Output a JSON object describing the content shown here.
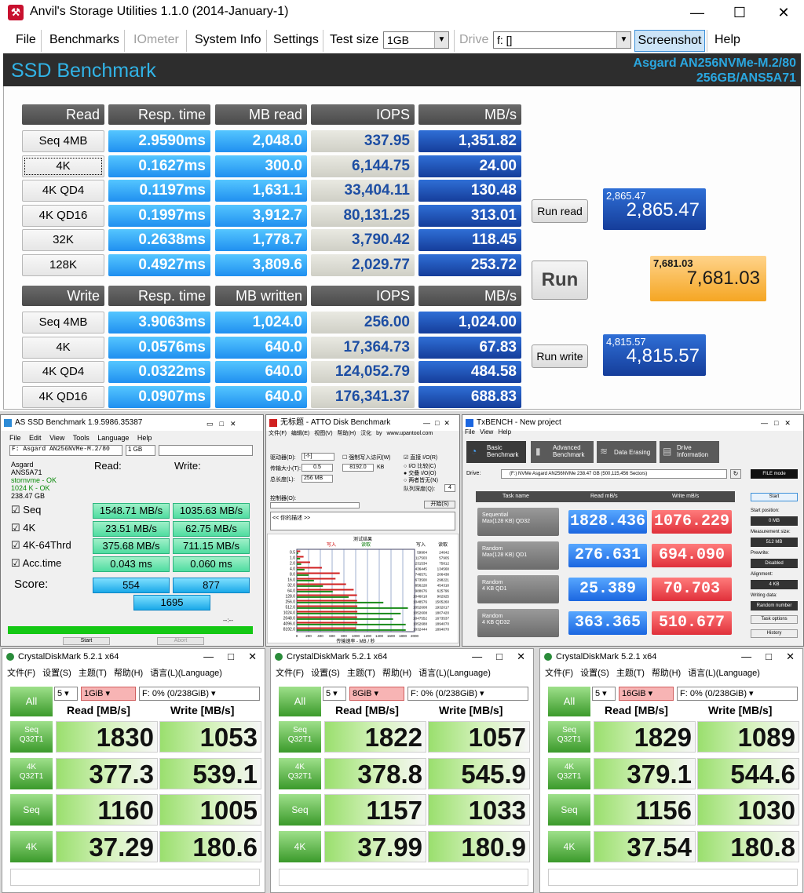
{
  "anvil": {
    "window_title": "Anvil's Storage Utilities 1.1.0 (2014-January-1)",
    "app_icon": "anvil-app-icon",
    "controls": {
      "minimize": "—",
      "maximize": "☐",
      "close": "✕"
    },
    "menu": {
      "file": "File",
      "benchmarks": "Benchmarks",
      "iometer": "IOmeter",
      "system_info": "System Info",
      "settings": "Settings",
      "test_size_label": "Test size",
      "test_size_value": "1GB",
      "drive_label": "Drive",
      "drive_value": "f: []",
      "screenshot": "Screenshot",
      "help": "Help"
    },
    "header": {
      "title": "SSD Benchmark",
      "model_line1": "Asgard AN256NVMe-M.2/80",
      "model_line2": "256GB/ANS5A71"
    },
    "read_headers": [
      "Read",
      "Resp. time",
      "MB read",
      "IOPS",
      "MB/s"
    ],
    "read_rows": [
      {
        "label": "Seq 4MB",
        "resp": "2.9590ms",
        "mb": "2,048.0",
        "iops": "337.95",
        "mbs": "1,351.82"
      },
      {
        "label": "4K",
        "resp": "0.1627ms",
        "mb": "300.0",
        "iops": "6,144.75",
        "mbs": "24.00"
      },
      {
        "label": "4K QD4",
        "resp": "0.1197ms",
        "mb": "1,631.1",
        "iops": "33,404.11",
        "mbs": "130.48"
      },
      {
        "label": "4K QD16",
        "resp": "0.1997ms",
        "mb": "3,912.7",
        "iops": "80,131.25",
        "mbs": "313.01"
      },
      {
        "label": "32K",
        "resp": "0.2638ms",
        "mb": "1,778.7",
        "iops": "3,790.42",
        "mbs": "118.45"
      },
      {
        "label": "128K",
        "resp": "0.4927ms",
        "mb": "3,809.6",
        "iops": "2,029.77",
        "mbs": "253.72"
      }
    ],
    "write_headers": [
      "Write",
      "Resp. time",
      "MB written",
      "IOPS",
      "MB/s"
    ],
    "write_rows": [
      {
        "label": "Seq 4MB",
        "resp": "3.9063ms",
        "mb": "1,024.0",
        "iops": "256.00",
        "mbs": "1,024.00"
      },
      {
        "label": "4K",
        "resp": "0.0576ms",
        "mb": "640.0",
        "iops": "17,364.73",
        "mbs": "67.83"
      },
      {
        "label": "4K QD4",
        "resp": "0.0322ms",
        "mb": "640.0",
        "iops": "124,052.79",
        "mbs": "484.58"
      },
      {
        "label": "4K QD16",
        "resp": "0.0907ms",
        "mb": "640.0",
        "iops": "176,341.37",
        "mbs": "688.83"
      }
    ],
    "run_read": "Run read",
    "run": "Run",
    "run_write": "Run write",
    "score_read": {
      "small": "2,865.47",
      "big": "2,865.47"
    },
    "score_total": {
      "small": "7,681.03",
      "big": "7,681.03"
    },
    "score_write": {
      "small": "4,815.57",
      "big": "4,815.57"
    },
    "colors": {
      "header_bg": "#2d2d2d",
      "title": "#31b3e6",
      "light_blue": "#1f8ff0",
      "dark_blue": "#153d9a",
      "orange": "#f5a623"
    }
  },
  "asssd": {
    "title": "AS SSD Benchmark 1.9.5986.35387",
    "menu": [
      "File",
      "Edit",
      "View",
      "Tools",
      "Language",
      "Help"
    ],
    "drive_select": "F: Asgard AN256NVMe-M.2/80",
    "size_select": "1 GB",
    "info": [
      "Asgard",
      "ANS5A71",
      "stornvme - OK",
      "1024 K - OK",
      "238.47 GB"
    ],
    "read_hdr": "Read:",
    "write_hdr": "Write:",
    "rows": [
      {
        "label": "Seq",
        "read": "1548.71 MB/s",
        "write": "1035.63 MB/s"
      },
      {
        "label": "4K",
        "read": "23.51 MB/s",
        "write": "62.75 MB/s"
      },
      {
        "label": "4K-64Thrd",
        "read": "375.68 MB/s",
        "write": "711.15 MB/s"
      },
      {
        "label": "Acc.time",
        "read": "0.043 ms",
        "write": "0.060 ms"
      }
    ],
    "score_label": "Score:",
    "score_read": "554",
    "score_write": "877",
    "score_total": "1695",
    "time": "--:--",
    "start": "Start",
    "abort": "Abort"
  },
  "atto": {
    "title": "无标题 - ATTO Disk Benchmark",
    "menu": [
      "文件(F)",
      "编辑(E)",
      "视图(V)",
      "帮助(H)",
      "汉化 by www.upantool.com"
    ],
    "drive_label": "驱动器(D):",
    "drive_value": "[-f-]",
    "xfer_label": "传输大小(T):",
    "xfer_from": "0.5",
    "xfer_to": "8192.0",
    "xfer_unit": "KB",
    "len_label": "总长度(L):",
    "len_value": "256 MB",
    "force_write": "强制写入访问(W)",
    "direct_io": "直接 I/O(R)",
    "io_compare": "I/O 比较(C)",
    "overlap_io": "交叠 I/O(O)",
    "neither": "两者皆无(N)",
    "queue_label": "队列深度(Q):",
    "queue_value": "4",
    "ctrl_label": "控制器(O):",
    "start": "开始(S)",
    "desc_label": "<< 你的描述 >>",
    "chart_title": "测试结果",
    "legend_write": "写入",
    "legend_read": "读取",
    "xlabel": "传输速率 - MB / 秒",
    "col_write": "写入",
    "col_read": "读取",
    "chart_data": {
      "type": "bar",
      "categories": [
        "0.5",
        "1.0",
        "2.0",
        "4.0",
        "8.0",
        "16.0",
        "32.0",
        "64.0",
        "128.0",
        "256.0",
        "512.0",
        "1024.0",
        "2048.0",
        "4096.0",
        "8192.0"
      ],
      "xlim": [
        0,
        2000
      ],
      "xticks": [
        "0",
        "200",
        "400",
        "600",
        "800",
        "1000",
        "1200",
        "1400",
        "1600",
        "1800",
        "2000"
      ],
      "series": [
        {
          "name": "写入",
          "values": [
            59904,
            117503,
            231534,
            436445,
            746571,
            673500,
            856228,
            988676,
            1046018,
            1048576,
            1052608,
            1052608,
            1047552,
            1052688,
            1032444
          ]
        },
        {
          "name": "读取",
          "values": [
            24642,
            57905,
            75812,
            134568,
            206438,
            298221,
            454318,
            625796,
            902925,
            1505260,
            1932017,
            1807420,
            1673537,
            1894070,
            1894070
          ]
        }
      ]
    }
  },
  "txbench": {
    "title": "TxBENCH - New project",
    "menu": [
      "File",
      "View",
      "Help"
    ],
    "tabs": [
      "Basic Benchmark",
      "Advanced Benchmark",
      "Data Erasing",
      "Drive Information"
    ],
    "drive_label": "Drive:",
    "drive_value": "(F:) NVMe Asgard AN256NVMe  238.47 GB (500,115,456 Sectors)",
    "mode": "FILE mode",
    "cols": [
      "Task name",
      "Read mB/s",
      "Write mB/s"
    ],
    "rows": [
      {
        "name1": "Sequential",
        "name2": "Max(128 KB) QD32",
        "read": "1828.436",
        "write": "1076.229"
      },
      {
        "name1": "Random",
        "name2": "Max(128 KB) QD1",
        "read": "276.631",
        "write": "694.090"
      },
      {
        "name1": "Random",
        "name2": "4 KB QD1",
        "read": "25.389",
        "write": "70.703"
      },
      {
        "name1": "Random",
        "name2": "4 KB QD32",
        "read": "363.365",
        "write": "510.677"
      }
    ],
    "side": {
      "start": "Start",
      "start_pos_label": "Start position:",
      "start_pos": "0 MB",
      "meas_label": "Measurement size:",
      "meas": "512 MB",
      "prewrite_label": "Prewrite:",
      "prewrite": "Disabled",
      "align_label": "Alignment:",
      "align": "4 KB",
      "wdata_label": "Writing data:",
      "wdata": "Random number",
      "task_options": "Task options",
      "history": "History"
    }
  },
  "cdm": [
    {
      "title": "CrystalDiskMark 5.2.1 x64",
      "menu": "文件(F) 设置(S) 主题(T) 帮助(H) 语言(L)(Language)",
      "all": "All",
      "count": "5",
      "size": "1GiB",
      "drive": "F: 0% (0/238GiB)",
      "read_hdr": "Read [MB/s]",
      "write_hdr": "Write [MB/s]",
      "rows": [
        {
          "l1": "Seq",
          "l2": "Q32T1",
          "read": "1830",
          "write": "1053"
        },
        {
          "l1": "4K",
          "l2": "Q32T1",
          "read": "377.3",
          "write": "539.1"
        },
        {
          "l1": "Seq",
          "l2": "",
          "read": "1160",
          "write": "1005"
        },
        {
          "l1": "4K",
          "l2": "",
          "read": "37.29",
          "write": "180.6"
        }
      ]
    },
    {
      "title": "CrystalDiskMark 5.2.1 x64",
      "menu": "文件(F) 设置(S) 主题(T) 帮助(H) 语言(L)(Language)",
      "all": "All",
      "count": "5",
      "size": "8GiB",
      "drive": "F: 0% (0/238GiB)",
      "read_hdr": "Read [MB/s]",
      "write_hdr": "Write [MB/s]",
      "rows": [
        {
          "l1": "Seq",
          "l2": "Q32T1",
          "read": "1822",
          "write": "1057"
        },
        {
          "l1": "4K",
          "l2": "Q32T1",
          "read": "378.8",
          "write": "545.9"
        },
        {
          "l1": "Seq",
          "l2": "",
          "read": "1157",
          "write": "1033"
        },
        {
          "l1": "4K",
          "l2": "",
          "read": "37.99",
          "write": "180.9"
        }
      ]
    },
    {
      "title": "CrystalDiskMark 5.2.1 x64",
      "menu": "文件(F) 设置(S) 主题(T) 帮助(H) 语言(L)(Language)",
      "all": "All",
      "count": "5",
      "size": "16GiB",
      "drive": "F: 0% (0/238GiB)",
      "read_hdr": "Read [MB/s]",
      "write_hdr": "Write [MB/s]",
      "rows": [
        {
          "l1": "Seq",
          "l2": "Q32T1",
          "read": "1829",
          "write": "1089"
        },
        {
          "l1": "4K",
          "l2": "Q32T1",
          "read": "379.1",
          "write": "544.6"
        },
        {
          "l1": "Seq",
          "l2": "",
          "read": "1156",
          "write": "1030"
        },
        {
          "l1": "4K",
          "l2": "",
          "read": "37.54",
          "write": "180.8"
        }
      ]
    }
  ]
}
